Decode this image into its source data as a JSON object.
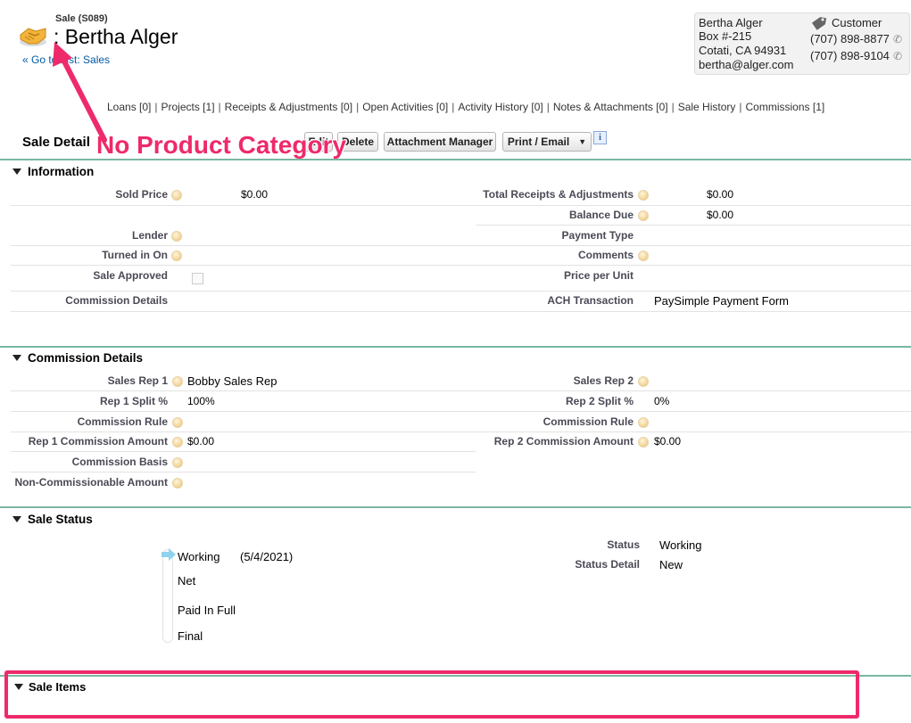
{
  "header": {
    "object_label": "Sale (S089)",
    "title": ": Bertha Alger",
    "back_link": "« Go to List: Sales"
  },
  "contact": {
    "name": "Bertha Alger",
    "address1": "Box #-215",
    "address2": "Cotati, CA 94931",
    "email": "bertha@alger.com",
    "type": "Customer",
    "phone1": "(707) 898-8877",
    "phone2": "(707) 898-9104"
  },
  "related_links": [
    "Loans [0]",
    "Projects [1]",
    "Receipts & Adjustments [0]",
    "Open Activities [0]",
    "Activity History [0]",
    "Notes & Attachments [0]",
    "Sale History",
    "Commissions [1]"
  ],
  "toolbar": {
    "section_title": "Sale Detail",
    "edit_label": "Edit",
    "delete_label": "Delete",
    "attachment_label": "Attachment Manager",
    "print_label": "Print / Email"
  },
  "annotation": {
    "callout": "No Product Category",
    "accent": "#ee2a6a"
  },
  "information": {
    "title": "Information",
    "sold_price_label": "Sold Price",
    "sold_price": "$0.00",
    "total_receipts_label": "Total Receipts & Adjustments",
    "total_receipts": "$0.00",
    "balance_due_label": "Balance Due",
    "balance_due": "$0.00",
    "lender_label": "Lender",
    "payment_type_label": "Payment Type",
    "turned_in_label": "Turned in On",
    "comments_label": "Comments",
    "sale_approved_label": "Sale Approved",
    "price_per_unit_label": "Price per Unit",
    "commission_details_label": "Commission Details",
    "ach_label": "ACH Transaction",
    "ach_link": "PaySimple Payment Form"
  },
  "commission": {
    "title": "Commission Details",
    "rep1_label": "Sales Rep 1",
    "rep1": "Bobby Sales Rep",
    "rep2_label": "Sales Rep 2",
    "rep1_split_label": "Rep 1 Split %",
    "rep1_split": "100%",
    "rep2_split_label": "Rep 2 Split %",
    "rep2_split": "0%",
    "rule1_label": "Commission Rule",
    "rule2_label": "Commission Rule",
    "rep1_amount_label": "Rep 1 Commission Amount",
    "rep1_amount": "$0.00",
    "rep2_amount_label": "Rep 2 Commission Amount",
    "rep2_amount": "$0.00",
    "basis_label": "Commission Basis",
    "noncomm_label": "Non-Commissionable Amount"
  },
  "status": {
    "title": "Sale Status",
    "stages": [
      "Working",
      "Net",
      "Paid In Full",
      "Final"
    ],
    "current_date": "(5/4/2021)",
    "status_label": "Status",
    "status_value": "Working",
    "detail_label": "Status Detail",
    "detail_value": "New"
  },
  "sale_items": {
    "title": "Sale Items"
  }
}
